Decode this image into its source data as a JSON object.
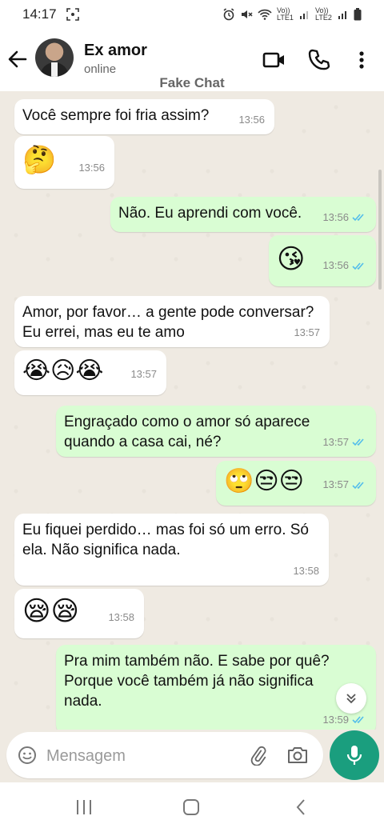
{
  "status_bar": {
    "time": "14:17",
    "carrier1": "Vo)) LTE1",
    "carrier2": "Vo)) LTE2"
  },
  "header": {
    "contact_name": "Ex amor",
    "presence": "online",
    "watermark": "Fake Chat"
  },
  "icons": [
    "back-arrow-icon",
    "video-call-icon",
    "phone-icon",
    "more-vert-icon",
    "emoji-icon",
    "attach-icon",
    "camera-icon",
    "mic-icon",
    "scroll-down-icon"
  ],
  "messages": [
    {
      "dir": "in",
      "text": "Você sempre foi fria assim?",
      "time": "13:56"
    },
    {
      "dir": "in",
      "text": "🤔",
      "time": "13:56"
    },
    {
      "dir": "out",
      "text": "Não. Eu aprendi com você.",
      "time": "13:56"
    },
    {
      "dir": "out",
      "text": "😘",
      "time": "13:56"
    },
    {
      "dir": "in",
      "text": "Amor, por favor… a gente pode conversar? Eu errei, mas eu te amo",
      "time": "13:57"
    },
    {
      "dir": "in",
      "text": "😭😥😭",
      "time": "13:57"
    },
    {
      "dir": "out",
      "text": "Engraçado como o amor só aparece quando a casa cai, né?",
      "time": "13:57"
    },
    {
      "dir": "out",
      "text": "🙄😒😒",
      "time": "13:57"
    },
    {
      "dir": "in",
      "text": "Eu fiquei perdido… mas foi só um erro. Só ela. Não significa nada.",
      "time": "13:58"
    },
    {
      "dir": "in",
      "text": "😪😪",
      "time": "13:58"
    },
    {
      "dir": "out",
      "text": "Pra mim também não. E sabe por quê? Porque você também já não significa nada.",
      "time": "13:59"
    }
  ],
  "composer": {
    "placeholder": "Mensagem"
  },
  "colors": {
    "incoming": "#ffffff",
    "outgoing": "#d9fdd3",
    "accent": "#1a9e7e",
    "read_ticks": "#53bdeb",
    "chat_bg": "#efeae2"
  }
}
